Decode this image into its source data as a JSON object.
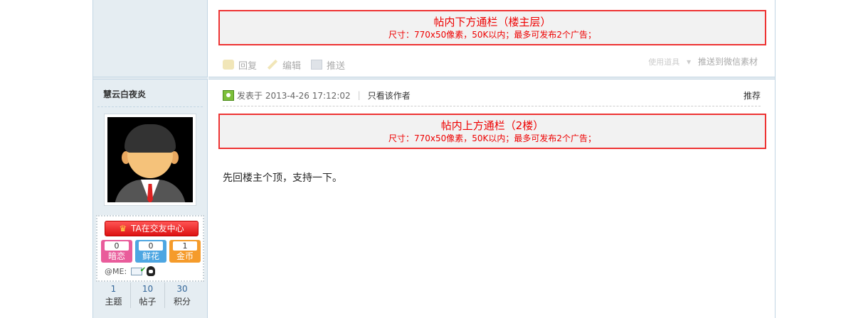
{
  "ads": {
    "top": {
      "title": "帖内下方通栏（楼主层）",
      "subtitle": "尺寸：770x50像素，50K以内；最多可发布2个广告；"
    },
    "floor2": {
      "title": "帖内上方通栏（2楼）",
      "subtitle": "尺寸：770x50像素，50K以内；最多可发布2个广告；"
    }
  },
  "actions": {
    "reply": "回复",
    "edit": "编辑",
    "push": "推送",
    "use_tool": "使用道具",
    "push_wechat": "推送到微信素材"
  },
  "post": {
    "posted_at": "发表于 2013-4-26 17:12:02",
    "author_only": "只看该作者",
    "recommend": "推荐",
    "content": "先回楼主个顶，支持一下。"
  },
  "user": {
    "name": "慧云白夜炎",
    "ta_button": "TA在交友中心",
    "stats": [
      {
        "value": "0",
        "label": "暗恋"
      },
      {
        "value": "0",
        "label": "鲜花"
      },
      {
        "value": "1",
        "label": "金币"
      }
    ],
    "me_label": "@ME:",
    "counts": [
      {
        "value": "1",
        "label": "主题"
      },
      {
        "value": "10",
        "label": "帖子"
      },
      {
        "value": "30",
        "label": "积分"
      }
    ]
  },
  "colors": {
    "sidebar_bg": "#e5edf2",
    "ad_border": "#ee3333",
    "accent_red": "#dd1111"
  }
}
